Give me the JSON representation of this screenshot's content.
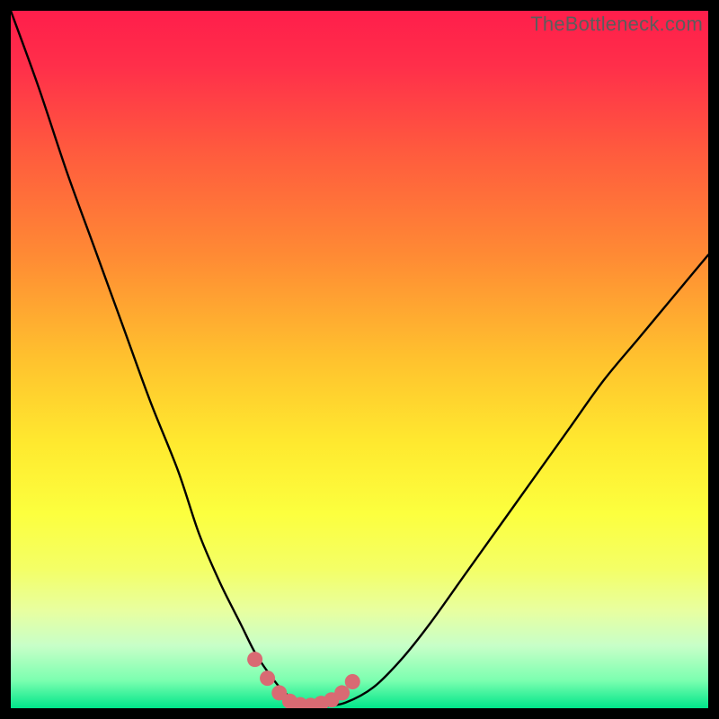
{
  "watermark": "TheBottleneck.com",
  "colors": {
    "gradient_stops": [
      {
        "offset": 0.0,
        "color": "#ff1e4b"
      },
      {
        "offset": 0.08,
        "color": "#ff2f4a"
      },
      {
        "offset": 0.2,
        "color": "#ff5a3e"
      },
      {
        "offset": 0.35,
        "color": "#ff8a34"
      },
      {
        "offset": 0.5,
        "color": "#ffc22e"
      },
      {
        "offset": 0.62,
        "color": "#ffe92f"
      },
      {
        "offset": 0.72,
        "color": "#fcff3e"
      },
      {
        "offset": 0.8,
        "color": "#f4ff66"
      },
      {
        "offset": 0.86,
        "color": "#e8ffa0"
      },
      {
        "offset": 0.91,
        "color": "#c8ffc8"
      },
      {
        "offset": 0.96,
        "color": "#7cffb0"
      },
      {
        "offset": 1.0,
        "color": "#00e58a"
      }
    ],
    "curve": "#000000",
    "marker_fill": "#d96a73",
    "marker_stroke": "#d96a73"
  },
  "chart_data": {
    "type": "line",
    "title": "",
    "xlabel": "",
    "ylabel": "",
    "xlim": [
      0,
      100
    ],
    "ylim": [
      0,
      100
    ],
    "grid": false,
    "legend": false,
    "series": [
      {
        "name": "bottleneck-curve",
        "x": [
          0,
          4,
          8,
          12,
          16,
          20,
          24,
          27,
          30,
          33,
          35,
          37,
          39,
          41,
          43,
          45,
          48,
          52,
          56,
          60,
          65,
          70,
          75,
          80,
          85,
          90,
          95,
          100
        ],
        "y": [
          100,
          89,
          77,
          66,
          55,
          44,
          34,
          25,
          18,
          12,
          8,
          5,
          2.5,
          1,
          0.3,
          0.3,
          0.8,
          3,
          7,
          12,
          19,
          26,
          33,
          40,
          47,
          53,
          59,
          65
        ]
      }
    ],
    "markers": {
      "name": "trough-markers",
      "x": [
        35.0,
        36.8,
        38.5,
        40.0,
        41.5,
        43.0,
        44.5,
        46.0,
        47.5,
        49.0
      ],
      "y": [
        7.0,
        4.3,
        2.2,
        1.0,
        0.5,
        0.4,
        0.7,
        1.2,
        2.2,
        3.8
      ]
    }
  }
}
